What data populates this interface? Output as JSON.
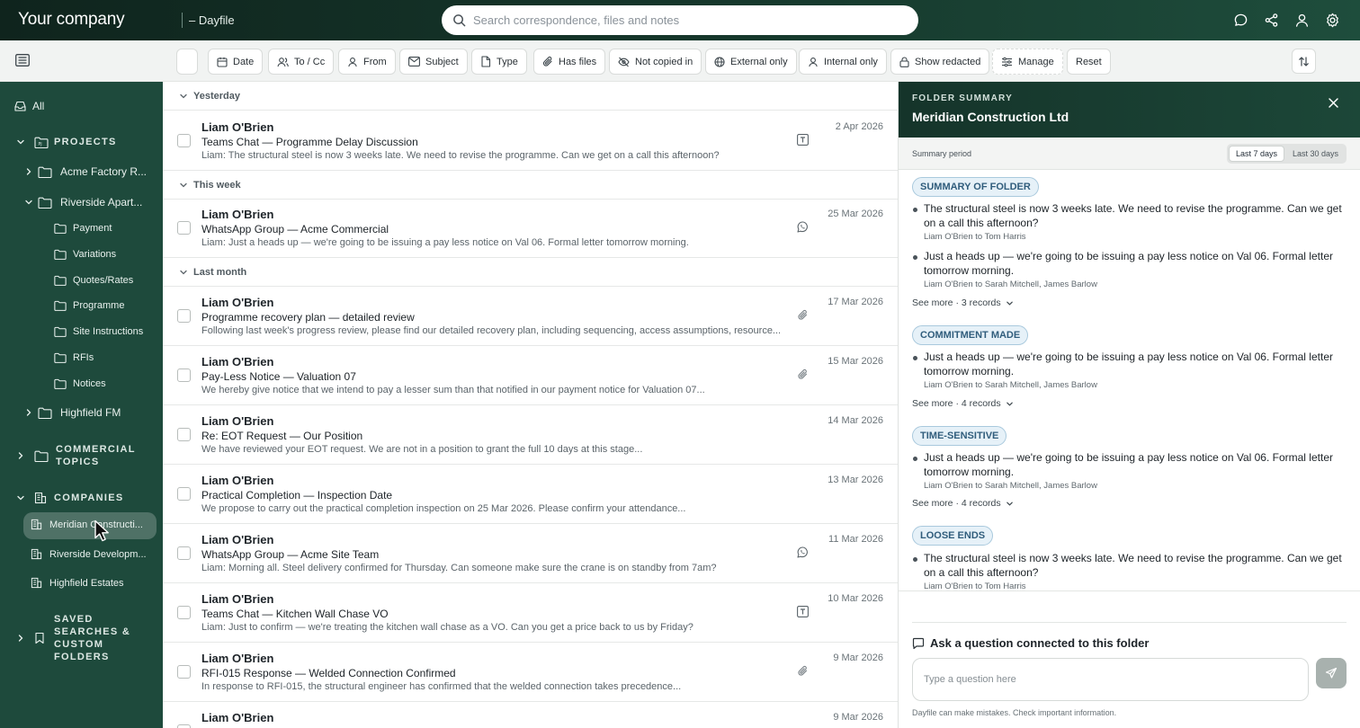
{
  "header": {
    "company": "Your company",
    "app_name": "– Dayfile",
    "search_placeholder": "Search correspondence, files and notes",
    "icons": [
      "chat-icon",
      "share-icon",
      "user-icon",
      "gear-icon"
    ]
  },
  "filters": {
    "chips": [
      "Date",
      "To / Cc",
      "From",
      "Subject",
      "Type",
      "Has files",
      "Not copied in",
      "External only",
      "Internal only",
      "Show redacted",
      "Manage",
      "Reset"
    ]
  },
  "sidebar": {
    "all": "All",
    "projects": {
      "title": "PROJECTS",
      "items": [
        "Acme Factory R...",
        "Riverside Apart...",
        "Highfield FM"
      ],
      "subitems": [
        "Payment",
        "Variations",
        "Quotes/Rates",
        "Programme",
        "Site Instructions",
        "RFIs",
        "Notices"
      ]
    },
    "commercial": {
      "title": "COMMERCIAL TOPICS"
    },
    "companies": {
      "title": "COMPANIES",
      "items": [
        "Meridian Constructi...",
        "Riverside Developm...",
        "Highfield Estates"
      ]
    },
    "saved": {
      "title": "SAVED SEARCHES & CUSTOM FOLDERS"
    }
  },
  "list": {
    "groups": [
      "Yesterday",
      "This week",
      "Last month"
    ],
    "rows": [
      {
        "sender": "Liam O'Brien",
        "subject": "Teams Chat — Programme Delay Discussion",
        "snippet": "Liam: The structural steel is now 3 weeks late. We need to revise the programme. Can we get on a call this afternoon?",
        "date": "2 Apr 2026",
        "icon": "teams-icon"
      },
      {
        "sender": "Liam O'Brien",
        "subject": "WhatsApp Group — Acme Commercial",
        "snippet": "Liam: Just a heads up — we're going to be issuing a pay less notice on Val 06. Formal letter tomorrow morning.",
        "date": "25 Mar 2026",
        "icon": "whatsapp-icon"
      },
      {
        "sender": "Liam O'Brien",
        "subject": "Programme recovery plan — detailed review",
        "snippet": "Following last week's progress review, please find our detailed recovery plan, including sequencing, access assumptions, resource...",
        "date": "17 Mar 2026",
        "icon": "paperclip-icon"
      },
      {
        "sender": "Liam O'Brien",
        "subject": "Pay-Less Notice — Valuation 07",
        "snippet": "We hereby give notice that we intend to pay a lesser sum than that notified in our payment notice for Valuation 07...",
        "date": "15 Mar 2026",
        "icon": "paperclip-icon"
      },
      {
        "sender": "Liam O'Brien",
        "subject": "Re: EOT Request — Our Position",
        "snippet": "We have reviewed your EOT request. We are not in a position to grant the full 10 days at this stage...",
        "date": "14 Mar 2026",
        "icon": ""
      },
      {
        "sender": "Liam O'Brien",
        "subject": "Practical Completion — Inspection Date",
        "snippet": "We propose to carry out the practical completion inspection on 25 Mar 2026. Please confirm your attendance...",
        "date": "13 Mar 2026",
        "icon": ""
      },
      {
        "sender": "Liam O'Brien",
        "subject": "WhatsApp Group — Acme Site Team",
        "snippet": "Liam: Morning all. Steel delivery confirmed for Thursday. Can someone make sure the crane is on standby from 7am?",
        "date": "11 Mar 2026",
        "icon": "whatsapp-icon"
      },
      {
        "sender": "Liam O'Brien",
        "subject": "Teams Chat — Kitchen Wall Chase VO",
        "snippet": "Liam: Just to confirm — we're treating the kitchen wall chase as a VO. Can you get a price back to us by Friday?",
        "date": "10 Mar 2026",
        "icon": "teams-icon"
      },
      {
        "sender": "Liam O'Brien",
        "subject": "RFI-015 Response — Welded Connection Confirmed",
        "snippet": "In response to RFI-015, the structural engineer has confirmed that the welded connection takes precedence...",
        "date": "9 Mar 2026",
        "icon": "paperclip-icon"
      },
      {
        "sender": "Liam O'Brien",
        "subject": "",
        "snippet": "",
        "date": "9 Mar 2026",
        "icon": ""
      }
    ]
  },
  "panel": {
    "caption": "FOLDER SUMMARY",
    "title": "Meridian Construction Ltd",
    "period_label": "Summary period",
    "period_options": [
      "Last 7 days",
      "Last 30 days"
    ],
    "period_selected": "Last 7 days",
    "sections": [
      {
        "badge": "SUMMARY OF FOLDER",
        "items": [
          {
            "text": "The structural steel is now 3 weeks late. We need to revise the programme. Can we get on a call this afternoon?",
            "meta": "Liam O'Brien to Tom Harris"
          },
          {
            "text": "Just a heads up — we're going to be issuing a pay less notice on Val 06. Formal letter tomorrow morning.",
            "meta": "Liam O'Brien to Sarah Mitchell, James Barlow"
          }
        ],
        "see_more": "See more · 3 records"
      },
      {
        "badge": "COMMITMENT MADE",
        "items": [
          {
            "text": "Just a heads up — we're going to be issuing a pay less notice on Val 06. Formal letter tomorrow morning.",
            "meta": "Liam O'Brien to Sarah Mitchell, James Barlow"
          }
        ],
        "see_more": "See more · 4 records"
      },
      {
        "badge": "TIME-SENSITIVE",
        "items": [
          {
            "text": "Just a heads up — we're going to be issuing a pay less notice on Val 06. Formal letter tomorrow morning.",
            "meta": "Liam O'Brien to Sarah Mitchell, James Barlow"
          }
        ],
        "see_more": "See more · 4 records"
      },
      {
        "badge": "LOOSE ENDS",
        "items": [
          {
            "text": "The structural steel is now 3 weeks late. We need to revise the programme. Can we get on a call this afternoon?",
            "meta": "Liam O'Brien to Tom Harris"
          }
        ]
      }
    ],
    "ask_title": "Ask a question connected to this folder",
    "ask_placeholder": "Type a question here",
    "disclaimer": "Dayfile can make mistakes. Check important information."
  }
}
